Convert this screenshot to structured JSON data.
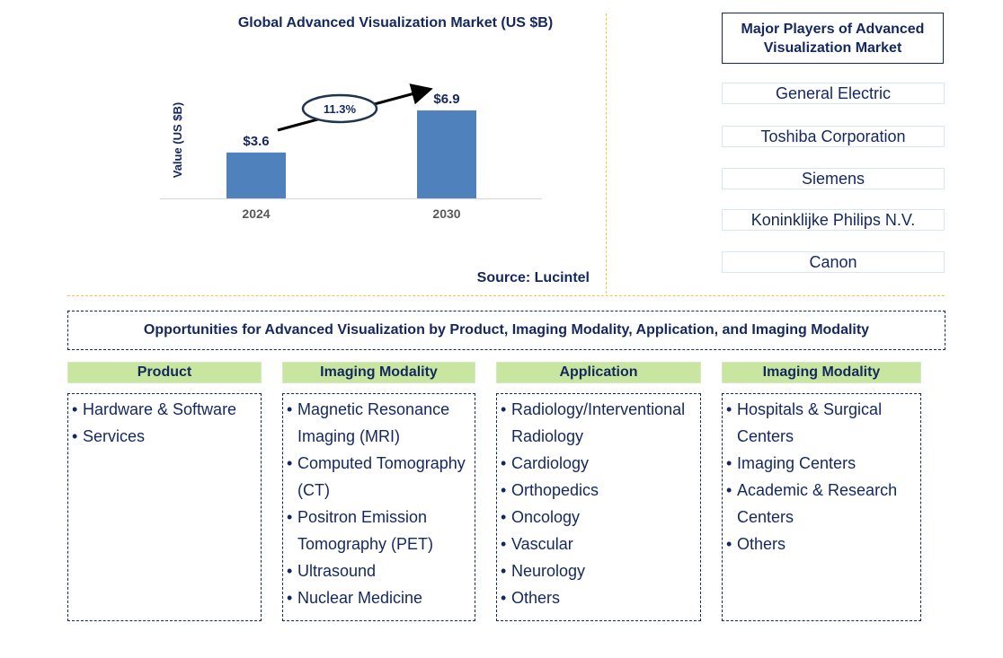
{
  "chart_data": {
    "type": "bar",
    "title": "Global Advanced Visualization Market (US $B)",
    "xlabel": "",
    "ylabel": "Value (US $B)",
    "categories": [
      "2024",
      "2030"
    ],
    "values": [
      3.6,
      6.9
    ],
    "data_labels": [
      "$3.6",
      "$6.9"
    ],
    "ylim": [
      0,
      7.5
    ],
    "grid": false,
    "legend": "none",
    "annotation": {
      "type": "cagr-arrow",
      "label": "11.3%"
    },
    "bar_color": "#4f81bd",
    "source": "Source: Lucintel"
  },
  "players": {
    "title": "Major Players of Advanced Visualization Market",
    "items": [
      "General Electric",
      "Toshiba Corporation",
      "Siemens",
      "Koninklijke Philips N.V.",
      "Canon"
    ]
  },
  "opportunities": {
    "title": "Opportunities for Advanced Visualization by Product, Imaging Modality, Application, and Imaging Modality",
    "categories": [
      {
        "header": "Product",
        "items": [
          "Hardware & Software",
          "Services"
        ]
      },
      {
        "header": "Imaging Modality",
        "items": [
          "Magnetic Resonance Imaging (MRI)",
          "Computed Tomography (CT)",
          "Positron Emission Tomography (PET)",
          "Ultrasound",
          "Nuclear Medicine"
        ]
      },
      {
        "header": "Application",
        "items": [
          "Radiology/Interventional Radiology",
          "Cardiology",
          "Orthopedics",
          "Oncology",
          "Vascular",
          "Neurology",
          "Others"
        ]
      },
      {
        "header": "Imaging Modality",
        "items": [
          "Hospitals & Surgical Centers",
          "Imaging Centers",
          "Academic & Research Centers",
          "Others"
        ]
      }
    ]
  },
  "colors": {
    "text": "#14285f",
    "accent_separator": "#f5c542",
    "category_header_bg": "#c8e6a0"
  }
}
